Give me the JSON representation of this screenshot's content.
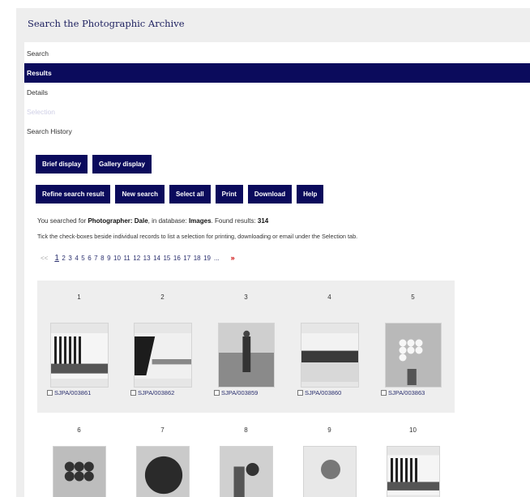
{
  "header": {
    "title": "Search the Photographic Archive"
  },
  "tabs": [
    {
      "label": "Search",
      "state": "normal"
    },
    {
      "label": "Results",
      "state": "active"
    },
    {
      "label": "Details",
      "state": "normal"
    },
    {
      "label": "Selection",
      "state": "disabled"
    },
    {
      "label": "Search History",
      "state": "normal"
    }
  ],
  "display_buttons": [
    {
      "label": "Brief display"
    },
    {
      "label": "Gallery display"
    }
  ],
  "action_buttons": [
    {
      "label": "Refine search result"
    },
    {
      "label": "New search"
    },
    {
      "label": "Select all"
    },
    {
      "label": "Print"
    },
    {
      "label": "Download"
    },
    {
      "label": "Help"
    }
  ],
  "search_info": {
    "prefix": "You searched for",
    "criteria": "Photographer: Dale",
    "mid": ", in database:",
    "database": "Images",
    "results_label": ". Found results:",
    "count": "314"
  },
  "instruction": "Tick the check-boxes beside individual records to list a selection for printing, downloading or email under the Selection tab.",
  "pager": {
    "prev": "<<",
    "pages": [
      "1",
      "2",
      "3",
      "4",
      "5",
      "6",
      "7",
      "8",
      "9",
      "10",
      "11",
      "12",
      "13",
      "14",
      "15",
      "16",
      "17",
      "18",
      "19"
    ],
    "current": "1",
    "ellipsis": "...",
    "next": "»"
  },
  "gallery": [
    {
      "num": "1",
      "id": "SJPA/003861",
      "icon": "photo-landscape-trees"
    },
    {
      "num": "2",
      "id": "SJPA/003862",
      "icon": "photo-lake-trees"
    },
    {
      "num": "3",
      "id": "SJPA/003859",
      "icon": "photo-man-road"
    },
    {
      "num": "4",
      "id": "SJPA/003860",
      "icon": "photo-field-hedge"
    },
    {
      "num": "5",
      "id": "SJPA/003863",
      "icon": "photo-daisies-vase"
    }
  ],
  "gallery_row2": [
    {
      "num": "6",
      "icon": "photo-flower-bouquet"
    },
    {
      "num": "7",
      "icon": "photo-tree-foliage"
    },
    {
      "num": "8",
      "icon": "photo-child-flowers"
    },
    {
      "num": "9",
      "icon": "photo-flower-vase"
    },
    {
      "num": "10",
      "icon": "photo-landscape-trees"
    }
  ],
  "colors": {
    "nav_dark": "#0b0b5c",
    "panel_grey": "#eeeeee",
    "link": "#2a2f6e",
    "next_arrow": "#cc0000"
  }
}
